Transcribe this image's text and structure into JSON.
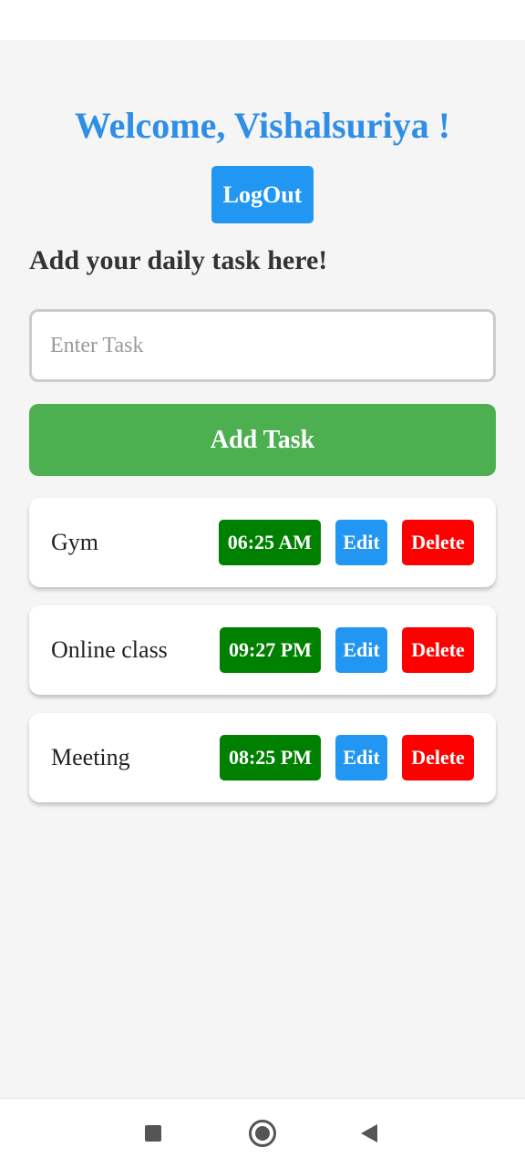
{
  "header": {
    "welcome_text": "Welcome, Vishalsuriya !",
    "logout_label": "LogOut"
  },
  "form": {
    "subheading": "Add your daily task here!",
    "task_input_placeholder": "Enter Task",
    "task_input_value": "",
    "add_button_label": "Add Task"
  },
  "tasks": [
    {
      "name": "Gym",
      "time": "06:25 AM",
      "edit_label": "Edit",
      "delete_label": "Delete"
    },
    {
      "name": "Online class",
      "time": "09:27 PM",
      "edit_label": "Edit",
      "delete_label": "Delete"
    },
    {
      "name": "Meeting",
      "time": "08:25 PM",
      "edit_label": "Edit",
      "delete_label": "Delete"
    }
  ],
  "system_nav": {
    "icons": [
      "recent-apps-icon",
      "home-icon",
      "back-icon"
    ]
  },
  "colors": {
    "welcome": "#2f8ee6",
    "primary_blue": "#2196f3",
    "add_green": "#4caf50",
    "time_green": "#008000",
    "delete_red": "#ff0000",
    "background": "#f5f5f5"
  }
}
